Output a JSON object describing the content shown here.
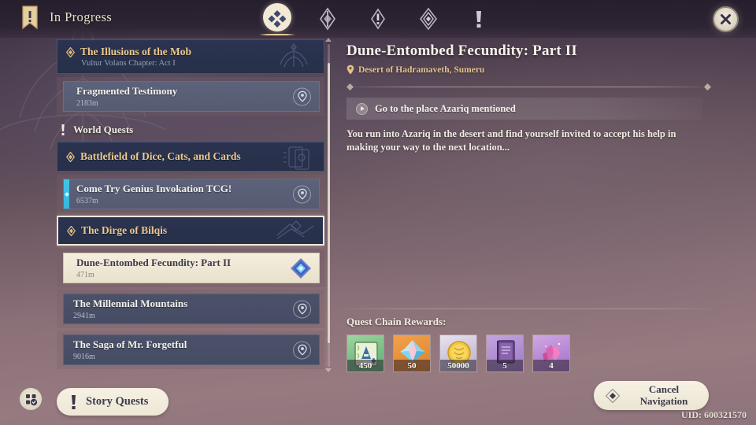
{
  "header": {
    "title": "In Progress",
    "banner_icon": "quest-banner-icon",
    "close_icon": "close-icon",
    "tabs": [
      {
        "id": "all",
        "icon": "four-diamonds-icon",
        "active": true
      },
      {
        "id": "archon",
        "icon": "archon-quest-icon",
        "active": false
      },
      {
        "id": "story",
        "icon": "story-quest-icon",
        "active": false
      },
      {
        "id": "world",
        "icon": "world-quest-icon",
        "active": false
      },
      {
        "id": "commission",
        "icon": "exclamation-icon",
        "active": false
      }
    ]
  },
  "quest_list": {
    "entries": [
      {
        "type": "chapter",
        "title": "The Illusions of the Mob",
        "subtitle": "Vultur Volans Chapter: Act I",
        "emblem": "wings-emblem",
        "selected": false
      },
      {
        "type": "quest",
        "name": "Fragmented Testimony",
        "distance": "2183m",
        "tracked": false,
        "selected": false,
        "pin_icon": "map-pin-icon"
      },
      {
        "type": "section",
        "label": "World Quests",
        "icon": "exclamation-icon"
      },
      {
        "type": "chapter",
        "title": "Battlefield of Dice, Cats, and Cards",
        "subtitle": "",
        "emblem": "cards-emblem",
        "selected": false
      },
      {
        "type": "quest",
        "name": "Come Try Genius Invokation TCG!",
        "distance": "6537m",
        "tracked": true,
        "selected": false,
        "pin_icon": "map-pin-icon"
      },
      {
        "type": "chapter",
        "title": "The Dirge of Bilqis",
        "subtitle": "",
        "emblem": "desert-emblem",
        "selected": true
      },
      {
        "type": "quest",
        "name": "Dune-Entombed Fecundity: Part II",
        "distance": "471m",
        "tracked": false,
        "selected": true,
        "reward_icon": "blue-diamond-reward-icon"
      },
      {
        "type": "quest-plain",
        "name": "The Millennial Mountains",
        "distance": "2941m",
        "pin_icon": "map-pin-icon"
      },
      {
        "type": "quest-plain",
        "name": "The Saga of Mr. Forgetful",
        "distance": "9016m",
        "pin_icon": "map-pin-icon"
      }
    ]
  },
  "detail": {
    "title": "Dune-Entombed Fecundity: Part II",
    "location": "Desert of Hadramaveth, Sumeru",
    "location_icon": "map-pin-icon",
    "objective": "Go to the place Azariq mentioned",
    "objective_icon": "play-arrow-icon",
    "description": "You run into Azariq in the desert and find yourself invited to accept his help in making your way to the next location...",
    "rewards_label": "Quest Chain Rewards:",
    "rewards": [
      {
        "icon": "adventure-exp-icon",
        "qty": "450"
      },
      {
        "icon": "primogem-icon",
        "qty": "50"
      },
      {
        "icon": "mora-icon",
        "qty": "50000"
      },
      {
        "icon": "hero-wit-icon",
        "qty": "5"
      },
      {
        "icon": "mystic-ore-icon",
        "qty": "4"
      }
    ]
  },
  "footer": {
    "filter_icon": "quest-filter-icon",
    "story_quests_label": "Story Quests",
    "story_quests_icon": "exclamation-icon",
    "cancel_label_line1": "Cancel",
    "cancel_label_line2": "Navigation",
    "cancel_icon": "diamond-icon",
    "uid": "UID: 600321570"
  },
  "colors": {
    "accent_gold": "#ebc98e",
    "track_cyan": "#3fc7e8",
    "panel_cream": "#f4eedd",
    "chapter_blue": "#2b3350"
  }
}
